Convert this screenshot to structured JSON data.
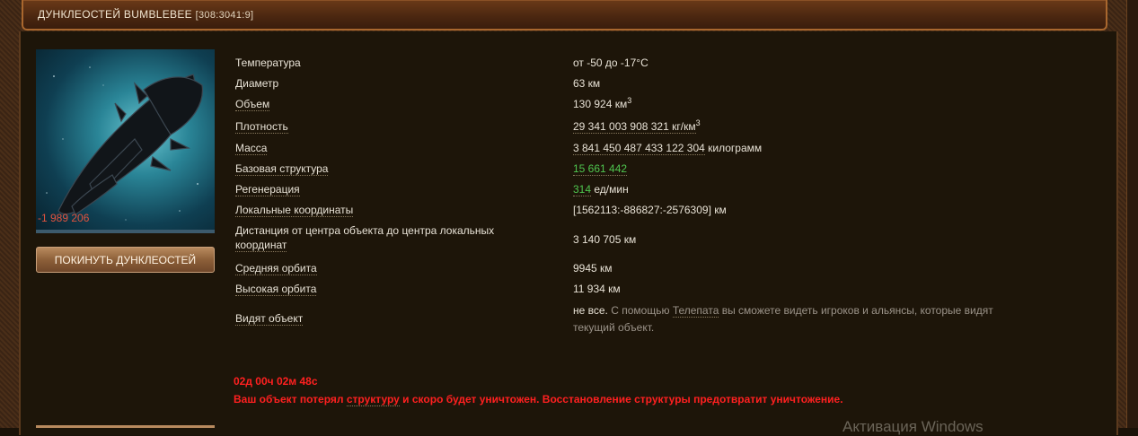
{
  "window": {
    "title": "ДУНКЛЕОСТЕЙ BUMBLEBEE",
    "coords": "[308:3041:9]"
  },
  "object": {
    "hp_loss": "-1 989 206",
    "leave_button": "ПОКИНУТЬ ДУНКЛЕОСТЕЙ"
  },
  "props": {
    "temperature": {
      "label": "Температура",
      "value": "от -50 до -17°C"
    },
    "diameter": {
      "label": "Диаметр",
      "value": "63 км"
    },
    "volume": {
      "label": "Объем",
      "value": "130 924 км",
      "sup": "3"
    },
    "density": {
      "label": "Плотность",
      "value": "29 341 003 908 321",
      "unit": "кг/км",
      "sup": "3"
    },
    "mass": {
      "label": "Масса",
      "value": "3 841 450 487 433 122 304",
      "unit": "килограмм"
    },
    "structure": {
      "label": "Базовая структура",
      "value": "15 661 442"
    },
    "regen": {
      "label": "Регенерация",
      "value": "314",
      "unit": "ед/мин"
    },
    "local_coords": {
      "label": "Локальные координаты",
      "value": "[1562113:-886827:-2576309] км"
    },
    "distance": {
      "label1": "Дистанция от центра объекта до центра локальных",
      "label2": "координат",
      "value": "3 140 705 км"
    },
    "mid_orbit": {
      "label": "Средняя орбита",
      "value": "9945 км"
    },
    "high_orbit": {
      "label": "Высокая орбита",
      "value": "11 934 км"
    },
    "visible": {
      "label": "Видят объект",
      "value": "не все.",
      "hint_pre": "С помощью",
      "hint_link": "Телепата",
      "hint_post": "вы сможете видеть игроков и альянсы, которые видят",
      "hint_line2": "текущий объект."
    }
  },
  "warning": {
    "timer": "02д 00ч 02м 48с",
    "msg_pre": "Ваш объект потерял",
    "msg_link": "структуру",
    "msg_post": "и скоро будет уничтожен. Восстановление структуры предотвратит уничтожение."
  },
  "os_watermark": "Активация Windows",
  "colors": {
    "accent": "#a9672e",
    "positive": "#4fc64f",
    "alert": "#ff2020",
    "damage": "#e0523e"
  }
}
